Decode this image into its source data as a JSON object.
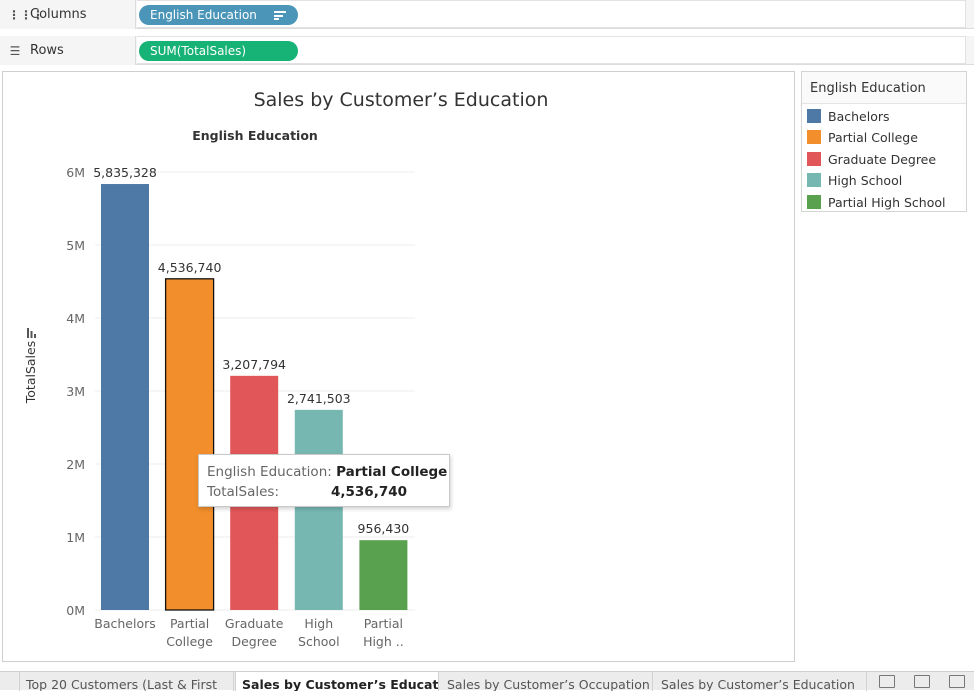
{
  "shelves": {
    "columns": {
      "label": "Columns",
      "pill": "English Education"
    },
    "rows": {
      "label": "Rows",
      "pill": "SUM(TotalSales)"
    }
  },
  "view": {
    "title": "Sales by Customer’s Education",
    "header": "English Education"
  },
  "legend": {
    "title": "English Education",
    "items": [
      {
        "label": "Bachelors",
        "color": "#4e79a7"
      },
      {
        "label": "Partial College",
        "color": "#f28e2b"
      },
      {
        "label": "Graduate Degree",
        "color": "#e15759"
      },
      {
        "label": "High School",
        "color": "#76b7b2"
      },
      {
        "label": "Partial High School",
        "color": "#59a14f"
      }
    ]
  },
  "chart_data": {
    "type": "bar",
    "title": "Sales by Customer’s Education",
    "xlabel": "English Education",
    "ylabel": "TotalSales",
    "ylim": [
      0,
      6000000
    ],
    "yticks": [
      "0M",
      "1M",
      "2M",
      "3M",
      "4M",
      "5M",
      "6M"
    ],
    "categories": [
      "Bachelors",
      "Partial College",
      "Graduate Degree",
      "High School",
      "Partial High School"
    ],
    "tick_labels": [
      [
        "Bachelors"
      ],
      [
        "Partial",
        "College"
      ],
      [
        "Graduate",
        "Degree"
      ],
      [
        "High",
        "School"
      ],
      [
        "Partial",
        "High .."
      ]
    ],
    "values": [
      5835328,
      4536740,
      3207794,
      2741503,
      956430
    ],
    "value_labels": [
      "5,835,328",
      "4,536,740",
      "3,207,794",
      "2,741,503",
      "956,430"
    ],
    "colors": [
      "#4e79a7",
      "#f28e2b",
      "#e15759",
      "#76b7b2",
      "#59a14f"
    ],
    "selected_index": 1,
    "grid": true
  },
  "tooltip": {
    "key1": "English Education:",
    "val1": "Partial College",
    "key2": "TotalSales:",
    "val2": "4,536,740"
  },
  "tabs": [
    {
      "label": "Top 20 Customers (Last & First",
      "active": false
    },
    {
      "label": "Sales by Customer’s Education",
      "active": true
    },
    {
      "label": "Sales by Customer’s Occupation",
      "active": false
    },
    {
      "label": "Sales by Customer’s Education",
      "active": false
    }
  ]
}
